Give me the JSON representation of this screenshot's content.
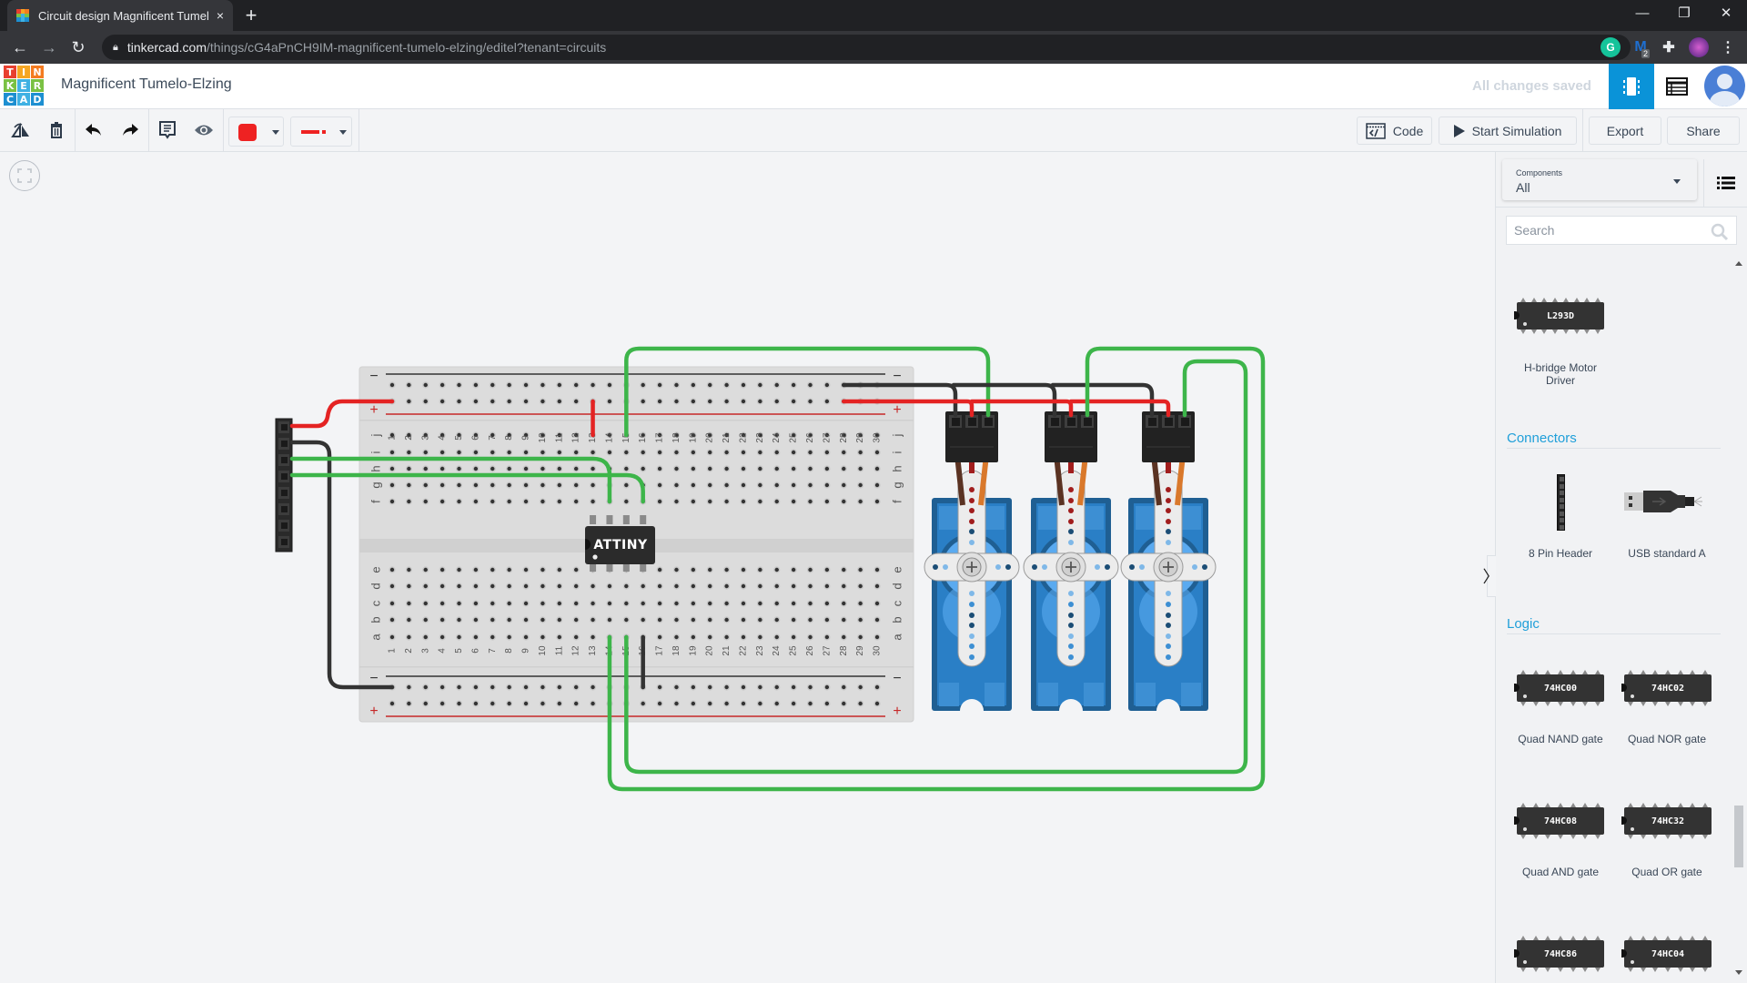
{
  "browser": {
    "tab_title": "Circuit design Magnificent Tumel",
    "tab_close": "×",
    "new_tab": "+",
    "url_host": "tinkercad.com",
    "url_path": "/things/cG4aPnCH9IM-magnificent-tumelo-elzing/editel?tenant=circuits",
    "extension_badge": "2",
    "window_controls": {
      "minimize": "—",
      "restore": "❐",
      "close": "✕"
    }
  },
  "app": {
    "logo_letters": [
      "T",
      "I",
      "N",
      "K",
      "E",
      "R",
      "C",
      "A",
      "D"
    ],
    "logo_colors": [
      "#e8402f",
      "#f5a623",
      "#f47b20",
      "#7ac143",
      "#3fb1e3",
      "#7ac143",
      "#1d8fd1",
      "#3fb1e3",
      "#1d8fd1"
    ],
    "design_title": "Magnificent Tumelo-Elzing",
    "save_status": "All changes saved",
    "accent_color": "#0a93d8"
  },
  "toolbar": {
    "rotate_icon": "rotate",
    "delete_icon": "trash",
    "undo_icon": "undo",
    "redo_icon": "redo",
    "notes_icon": "notes",
    "visibility_icon": "eye",
    "wire_color": "#ee2222",
    "wire_style": "solid",
    "code_label": "Code",
    "start_simulation_label": "Start Simulation",
    "export_label": "Export",
    "share_label": "Share"
  },
  "panel": {
    "components_label": "Components",
    "components_value": "All",
    "search_placeholder": "Search",
    "sections": [
      {
        "title": null,
        "items": [
          {
            "chip": "L293D",
            "label_lines": [
              "H-bridge Motor",
              "Driver"
            ]
          }
        ]
      },
      {
        "title": "Connectors",
        "items": [
          {
            "label": "8 Pin Header"
          },
          {
            "label": "USB standard A"
          }
        ]
      },
      {
        "title": "Logic",
        "items": [
          {
            "chip": "74HC00",
            "label": "Quad NAND gate"
          },
          {
            "chip": "74HC02",
            "label": "Quad NOR gate"
          },
          {
            "chip": "74HC08",
            "label": "Quad AND gate"
          },
          {
            "chip": "74HC32",
            "label": "Quad OR gate"
          },
          {
            "chip": "74HC86",
            "label": ""
          },
          {
            "chip": "74HC04",
            "label": ""
          }
        ]
      }
    ],
    "collapse_glyph": "〉"
  },
  "circuit": {
    "breadboard": {
      "columns": 30,
      "top_rows": [
        "j",
        "i",
        "h",
        "g",
        "f"
      ],
      "bottom_rows": [
        "e",
        "d",
        "c",
        "b",
        "a"
      ],
      "rail_minus": "−",
      "rail_plus": "+"
    },
    "chip_label": "ATTINY",
    "servo_count": 3,
    "header_pins": 8,
    "wire_colors": {
      "power": "#e42323",
      "ground": "#333333",
      "signal": "#3db54a"
    }
  }
}
